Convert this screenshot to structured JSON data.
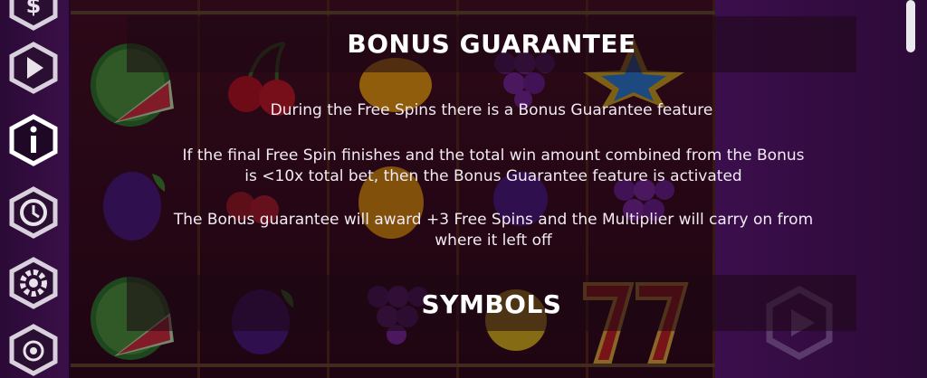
{
  "sections": [
    {
      "title": "BONUS GUARANTEE",
      "paragraphs": [
        "During the Free Spins there is a Bonus Guarantee feature",
        "If the final Free Spin finishes and the total win amount combined from the Bonus is <10x total bet, then the Bonus Guarantee feature is activated",
        "The Bonus guarantee will award +3 Free Spins and the Multiplier will carry on from where it left off"
      ]
    },
    {
      "title": "SYMBOLS",
      "paragraphs": []
    }
  ],
  "sidebar": {
    "buttons": [
      {
        "name": "bet-button",
        "icon": "dollar-icon"
      },
      {
        "name": "autoplay-button",
        "icon": "play-icon"
      },
      {
        "name": "info-button",
        "icon": "info-icon",
        "active": true
      },
      {
        "name": "history-button",
        "icon": "history-icon"
      },
      {
        "name": "settings-button",
        "icon": "gear-icon"
      },
      {
        "name": "extra-button",
        "icon": "badge-icon"
      }
    ]
  },
  "colors": {
    "accent_text": "#ffffff",
    "body_text": "#f2eaf4",
    "background": "#3a1048"
  }
}
